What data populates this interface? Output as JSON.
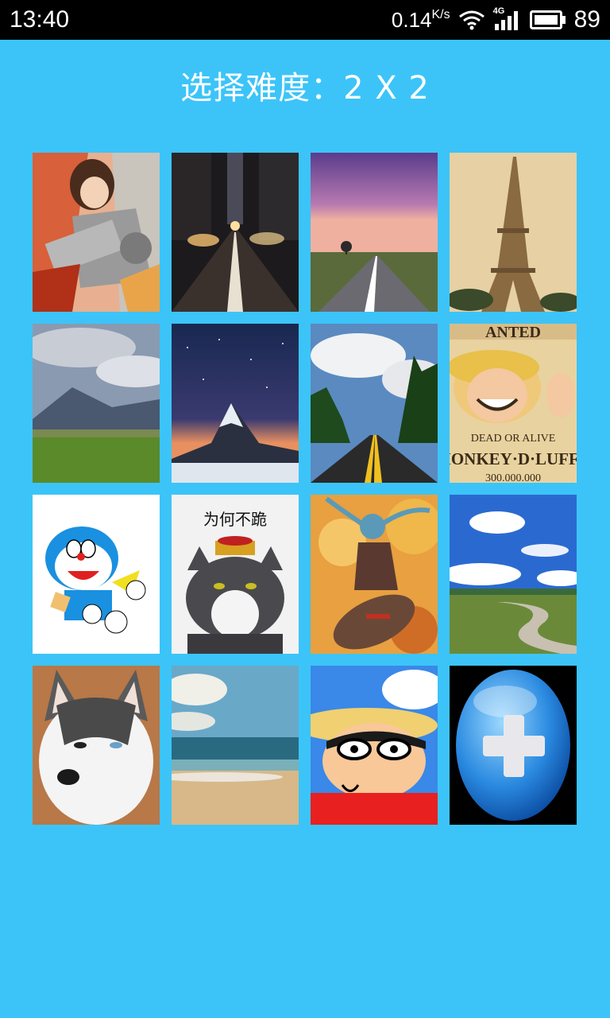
{
  "status_bar": {
    "time": "13:40",
    "net_speed": "0.14",
    "net_unit": "K/s",
    "network": "4G",
    "battery": "89"
  },
  "header": {
    "title": "选择难度：2 X 2"
  },
  "gallery": {
    "items": [
      {
        "name": "anime-warrior"
      },
      {
        "name": "city-street-night"
      },
      {
        "name": "road-purple-sky"
      },
      {
        "name": "eiffel-tower"
      },
      {
        "name": "mountain-meadow"
      },
      {
        "name": "starry-mountain"
      },
      {
        "name": "forest-road"
      },
      {
        "name": "wanted-poster-luffy"
      },
      {
        "name": "doraemon"
      },
      {
        "name": "emperor-cat"
      },
      {
        "name": "fantasy-heroine"
      },
      {
        "name": "countryside-path"
      },
      {
        "name": "husky-dog"
      },
      {
        "name": "beach-sea"
      },
      {
        "name": "crayon-shin-chan"
      },
      {
        "name": "add-picture"
      }
    ],
    "poster_text_1": "ANTED",
    "poster_text_2": "DEAD OR ALIVE",
    "poster_text_3": "MONKEY·D·LUFFY",
    "poster_text_4": "300.000.000",
    "cat_text": "为何不跪"
  }
}
